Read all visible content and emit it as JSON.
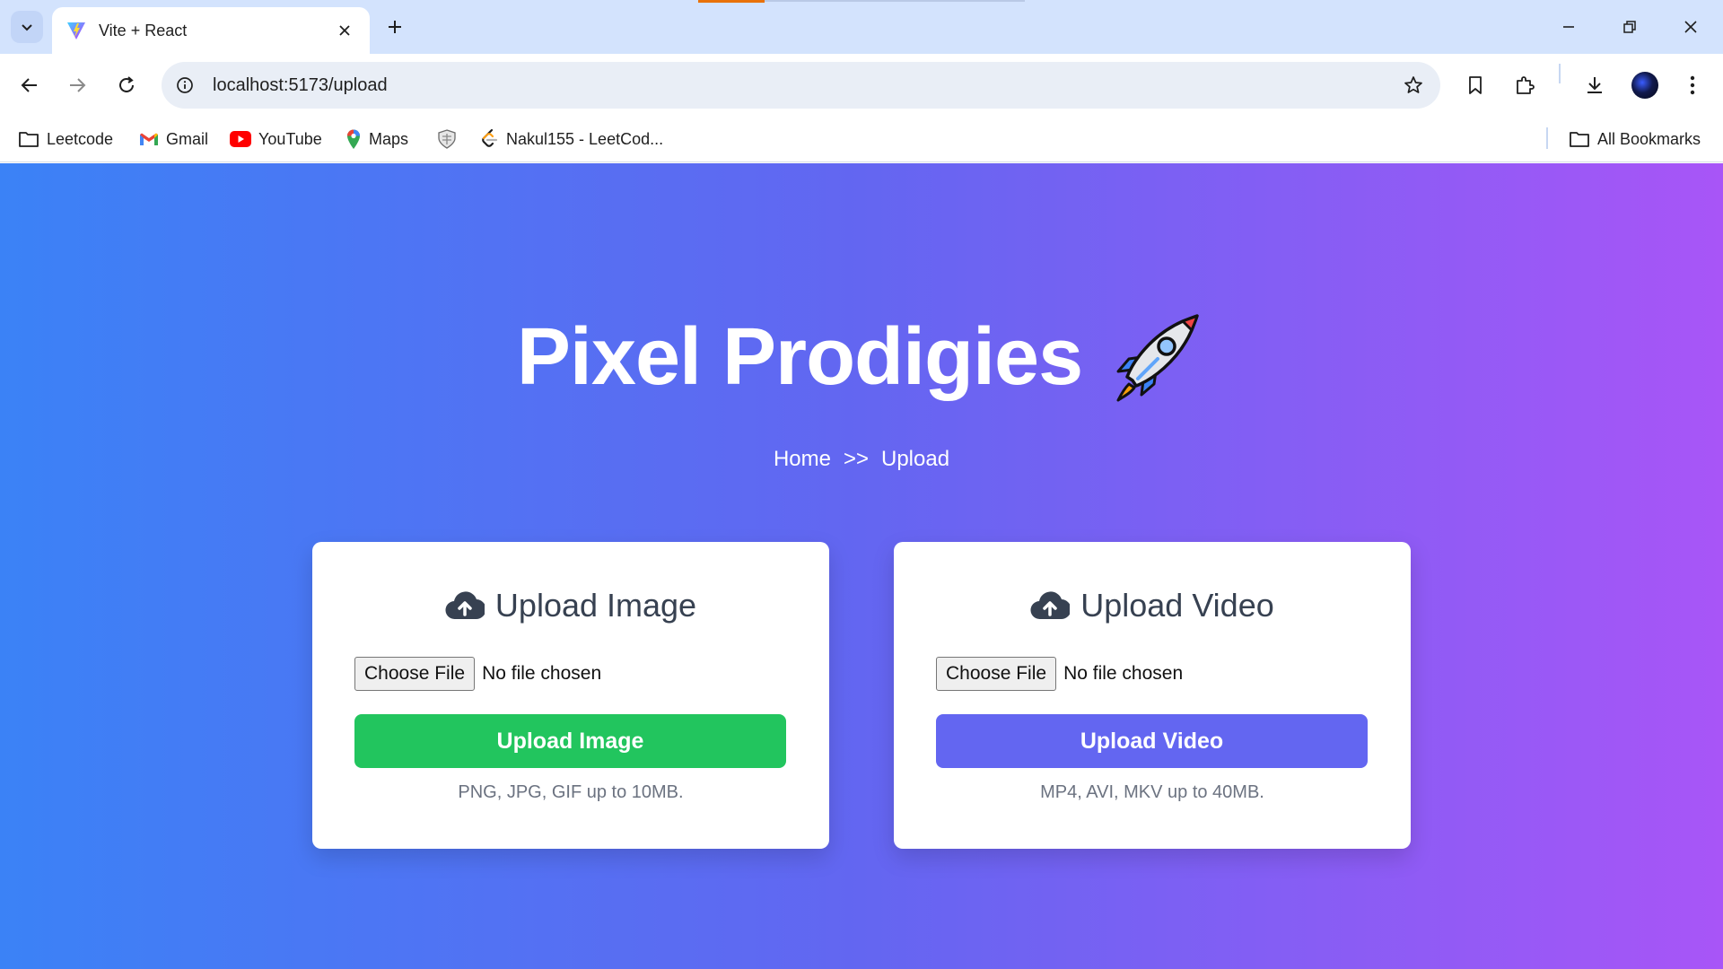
{
  "browser": {
    "tab": {
      "title": "Vite + React",
      "favicon": "vite-logo-icon"
    },
    "url": "localhost:5173/upload",
    "bookmarks": [
      {
        "label": "Leetcode",
        "icon": "folder-icon"
      },
      {
        "label": "Gmail",
        "icon": "gmail-icon"
      },
      {
        "label": "YouTube",
        "icon": "youtube-icon"
      },
      {
        "label": "Maps",
        "icon": "maps-icon"
      },
      {
        "label": "",
        "icon": "shield-crest-icon"
      },
      {
        "label": "Nakul155 - LeetCod...",
        "icon": "leetcode-icon"
      }
    ],
    "all_bookmarks": "All Bookmarks"
  },
  "page": {
    "brand_title": "Pixel Prodigies",
    "brand_icon": "rocket-icon",
    "breadcrumb": {
      "home": "Home",
      "separator": ">>",
      "current": "Upload"
    },
    "image_card": {
      "title": "Upload Image",
      "choose_label": "Choose File",
      "file_status": "No file chosen",
      "button_label": "Upload Image",
      "button_color": "#22c55e",
      "hint": "PNG, JPG, GIF up to 10MB."
    },
    "video_card": {
      "title": "Upload Video",
      "choose_label": "Choose File",
      "file_status": "No file chosen",
      "button_label": "Upload Video",
      "button_color": "#6366f1",
      "hint": "MP4, AVI, MKV up to 40MB."
    },
    "gradient": {
      "from": "#3b82f6",
      "via": "#6366f1",
      "to": "#a855f7"
    }
  }
}
